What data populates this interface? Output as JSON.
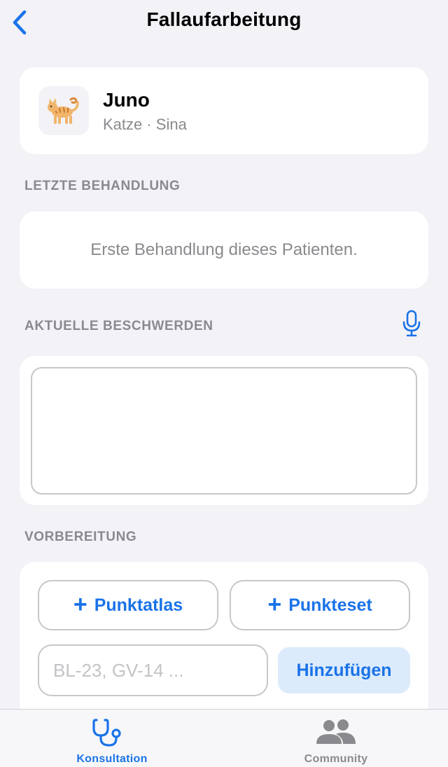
{
  "nav": {
    "title": "Fallaufarbeitung",
    "back_icon": "chevron-left-icon"
  },
  "patient": {
    "name": "Juno",
    "meta": "Katze · Sina",
    "avatar_icon": "cat-emoji"
  },
  "last_treatment": {
    "label": "LETZTE BEHANDLUNG",
    "text": "Erste Behandlung dieses Patienten."
  },
  "current_complaints": {
    "label": "AKTUELLE BESCHWERDEN",
    "value": "",
    "mic_icon": "microphone-icon"
  },
  "preparation": {
    "label": "VORBEREITUNG",
    "point_atlas_label": "Punktatlas",
    "point_set_label": "Punkteset",
    "point_input_placeholder": "BL-23, GV-14 ...",
    "point_input_value": "",
    "add_label": "Hinzufügen"
  },
  "tabbar": {
    "tabs": [
      {
        "label": "Konsultation",
        "icon": "stethoscope-icon",
        "selected": true
      },
      {
        "label": "Community",
        "icon": "people-icon",
        "selected": false
      }
    ]
  },
  "colors": {
    "accent": "#1a73e8",
    "background": "#f2f2f7",
    "card": "#ffffff",
    "secondary_text": "#8a8a8e",
    "button_fill": "#dcebfb"
  }
}
